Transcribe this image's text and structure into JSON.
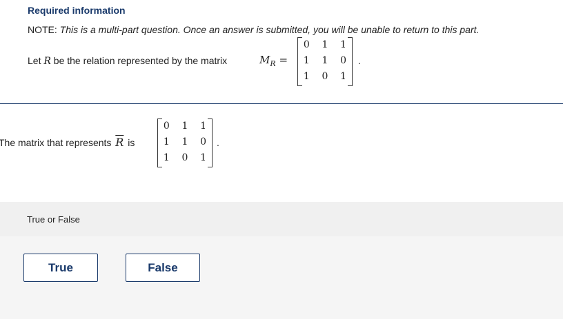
{
  "header": {
    "title": "Required information",
    "note_label": "NOTE:",
    "note_text": "This is a multi-part question. Once an answer is submitted, you will be unable to return to this part."
  },
  "relation": {
    "text_before": "Let",
    "rel_var": "R",
    "text_after": "be the relation represented by the matrix",
    "matrix_name": "M",
    "matrix_subscript": "R",
    "equals": "=",
    "period": ".",
    "matrix": [
      [
        "0",
        "1",
        "1"
      ],
      [
        "1",
        "1",
        "0"
      ],
      [
        "1",
        "0",
        "1"
      ]
    ]
  },
  "question": {
    "text_before": "The matrix that represents",
    "complement_var": "R",
    "text_after": "is",
    "period": ".",
    "matrix": [
      [
        "0",
        "1",
        "1"
      ],
      [
        "1",
        "1",
        "0"
      ],
      [
        "1",
        "0",
        "1"
      ]
    ]
  },
  "answer": {
    "type_label": "True or False",
    "true_label": "True",
    "false_label": "False"
  },
  "colors": {
    "accent": "#1a3a6b",
    "band": "#f0f0f0",
    "answer_bg": "#f5f5f5"
  }
}
